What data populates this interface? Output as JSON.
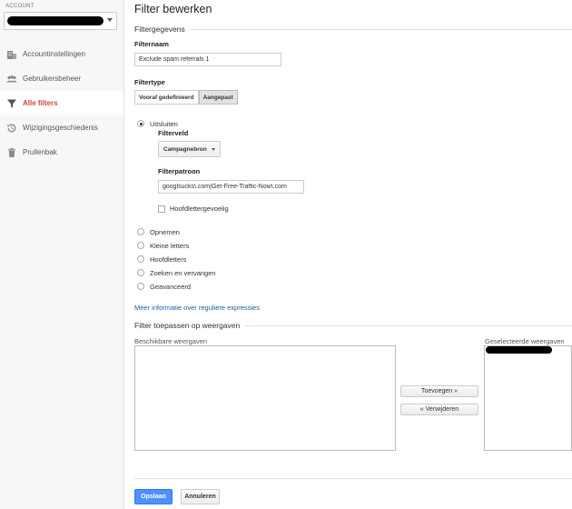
{
  "colors": {
    "accent_active": "#d44638",
    "link": "#1a5fa0",
    "primary_button": "#4d90fe"
  },
  "sidebar": {
    "account_label": "ACCOUNT",
    "items": [
      {
        "label": "Accountinstellingen",
        "icon": "building-icon"
      },
      {
        "label": "Gebruikersbeheer",
        "icon": "users-icon"
      },
      {
        "label": "Alle filters",
        "icon": "filter-icon",
        "active": true
      },
      {
        "label": "Wijzigingsgeschiedenis",
        "icon": "history-icon"
      },
      {
        "label": "Prullenbak",
        "icon": "trash-icon"
      }
    ]
  },
  "page": {
    "title": "Filter bewerken"
  },
  "filter_data": {
    "section_title": "Filtergegevens",
    "name_label": "Filternaam",
    "name_value": "Exclude spam referrals 1",
    "type_label": "Filtertype",
    "type_options": [
      "Vooraf gedefinieerd",
      "Aangepast"
    ],
    "type_selected": "Aangepast"
  },
  "custom": {
    "exclude_label": "Uitsluiten",
    "field_label": "Filterveld",
    "field_value": "Campagnebron",
    "pattern_label": "Filterpatroon",
    "pattern_value": "googlsucks\\.com|Get-Free-Traffic-Now\\.com",
    "case_sensitive_label": "Hoofdlettergevoelig",
    "other_options": [
      "Opnemen",
      "Kleine letters",
      "Hoofdletters",
      "Zoeken en vervangen",
      "Geavanceerd"
    ],
    "regex_link": "Meer informatie over reguliere expressies"
  },
  "views": {
    "section_title": "Filter toepassen op weergaven",
    "available_label": "Beschikbare weergaven",
    "selected_label": "Geselecteerde weergaven",
    "add_button": "Toevoegen »",
    "remove_button": "« Verwijderen"
  },
  "footer": {
    "save_button": "Opslaan",
    "cancel_button": "Annuleren"
  }
}
